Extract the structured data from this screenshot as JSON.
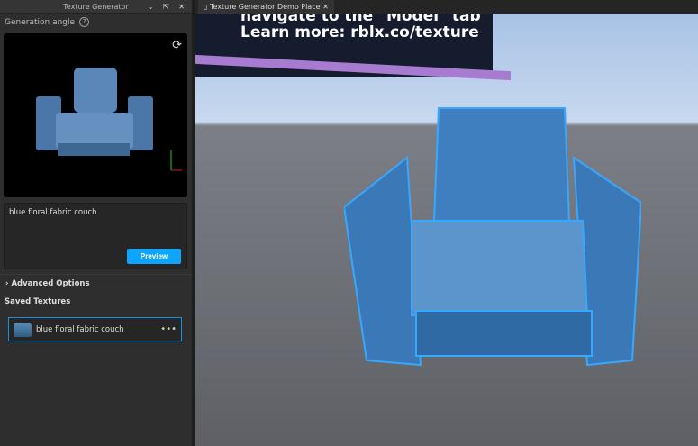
{
  "panel": {
    "title": "Texture Generator",
    "controls": "⌄ ⇱ ✕",
    "generation_angle": "Generation angle",
    "help": "?",
    "prompt": "blue floral fabric couch",
    "preview": "Preview",
    "advanced_options": "Advanced Options",
    "saved_textures": "Saved Textures",
    "saved_items": [
      {
        "label": "blue floral fabric couch"
      }
    ]
  },
  "viewport": {
    "tab": "Texture Generator Demo Place",
    "tab_close": "✕",
    "billboard_line1": "navigate to the \"Model\" tab",
    "billboard_line2": "Learn more: rblx.co/texture"
  },
  "colors": {
    "accent": "#0ea5ff",
    "selection": "#1a8fe0"
  }
}
